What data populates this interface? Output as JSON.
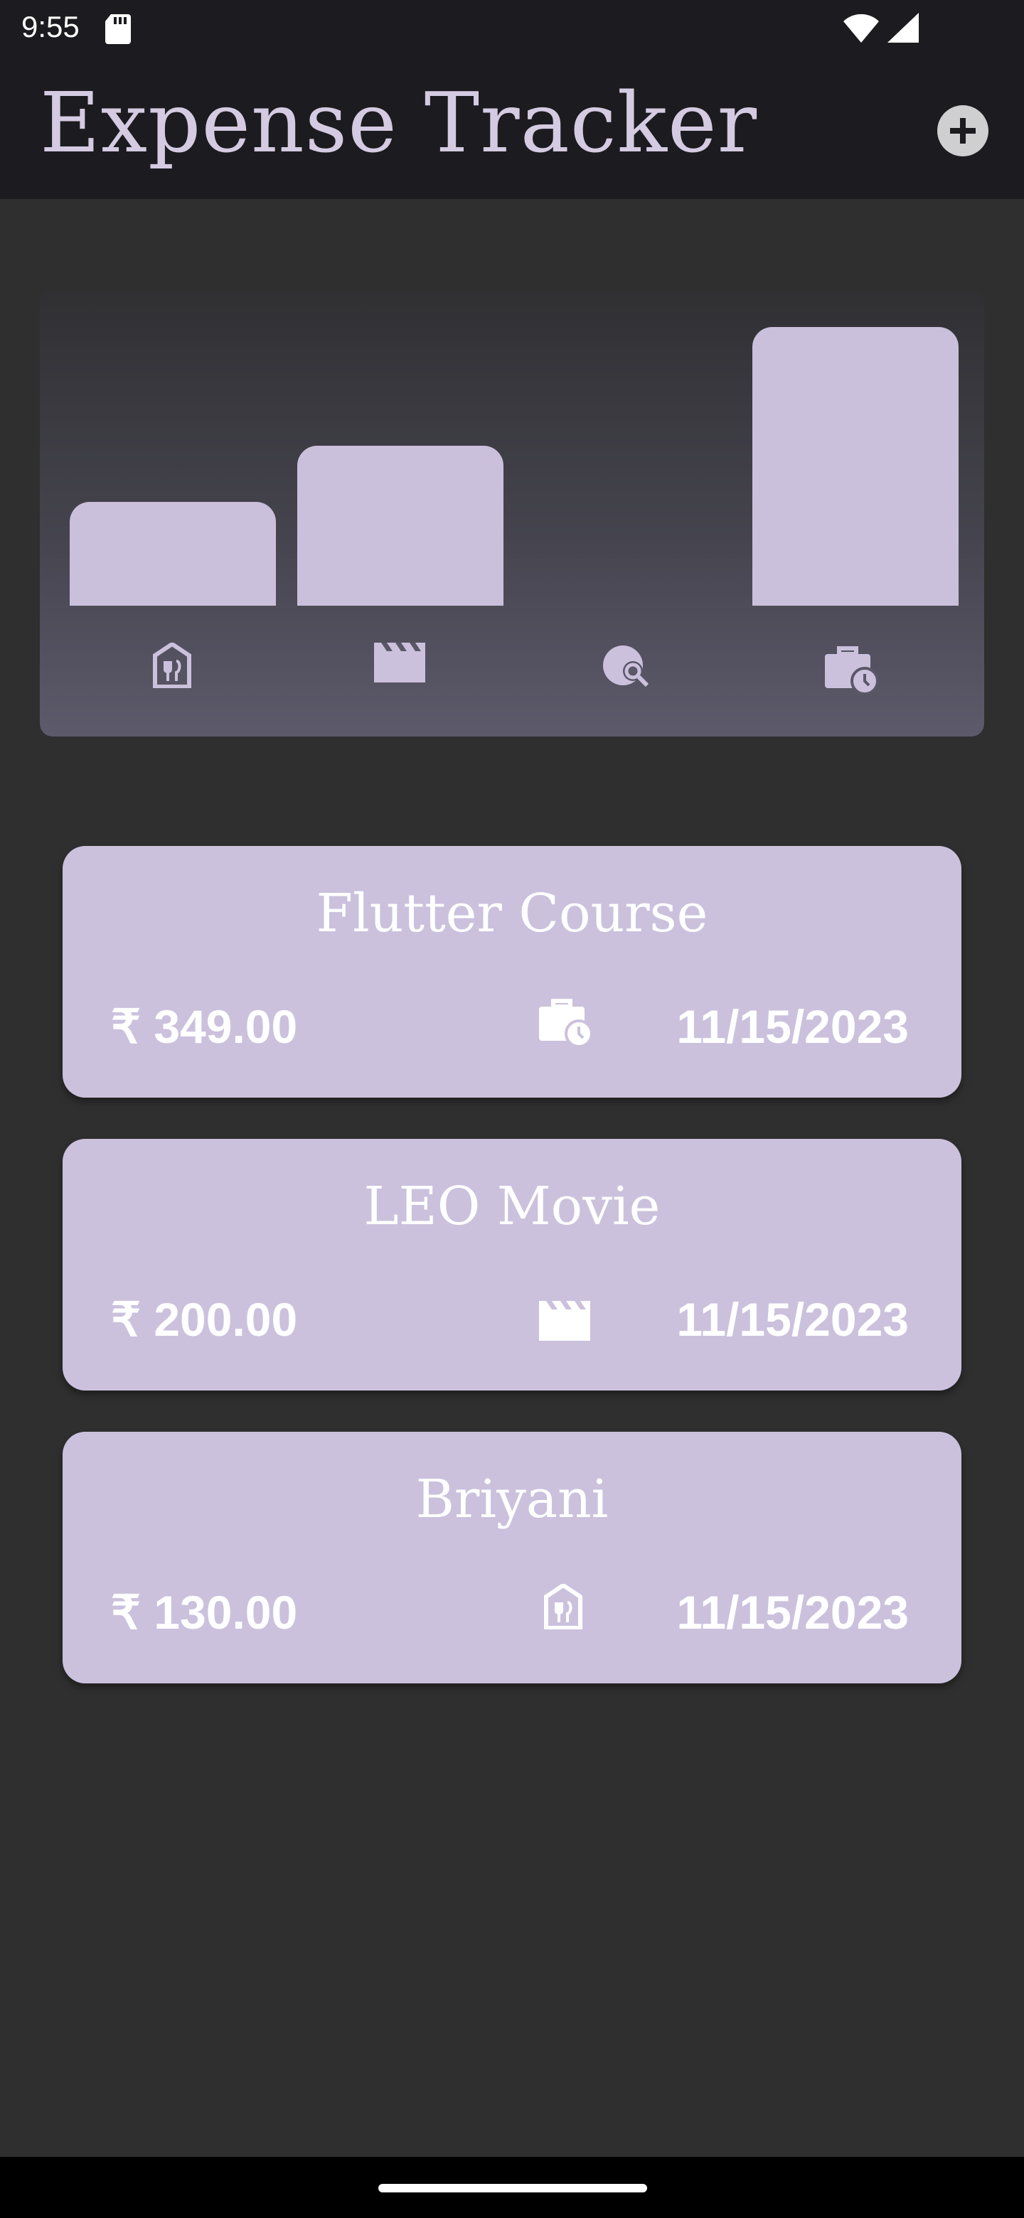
{
  "status_bar": {
    "time": "9:55"
  },
  "app_bar": {
    "title": "Expense Tracker",
    "add_icon": "add-circle-icon"
  },
  "colors": {
    "background": "#2f2f30",
    "app_bar": "#1c1b1f",
    "accent": "#cbc1dd",
    "title_text": "#d4cbe2"
  },
  "chart_data": {
    "type": "bar",
    "categories": [
      "food",
      "leisure",
      "travel",
      "work"
    ],
    "category_icons": [
      "restaurant-icon",
      "movie-icon",
      "travel-explore-icon",
      "work-history-icon"
    ],
    "values": [
      130,
      200,
      0,
      349
    ],
    "title": "",
    "xlabel": "",
    "ylabel": ""
  },
  "expenses": [
    {
      "title": "Flutter Course",
      "amount": "₹ 349.00",
      "category_icon": "work-history-icon",
      "date": "11/15/2023"
    },
    {
      "title": "LEO Movie",
      "amount": "₹ 200.00",
      "category_icon": "movie-icon",
      "date": "11/15/2023"
    },
    {
      "title": "Briyani",
      "amount": "₹ 130.00",
      "category_icon": "restaurant-icon",
      "date": "11/15/2023"
    }
  ]
}
